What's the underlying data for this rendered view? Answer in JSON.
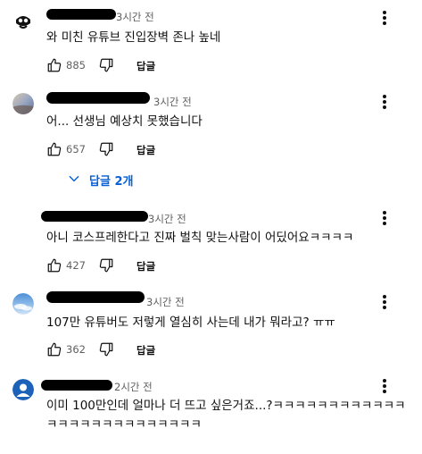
{
  "comments": [
    {
      "author": "",
      "time": "3시간 전",
      "text": "와 미친 유튜브 진입장벽 존나 높네",
      "likes": "885",
      "reply_label": "답글"
    },
    {
      "author": "",
      "time": "3시간 전",
      "text": "어... 선생님 예상치 못했습니다",
      "likes": "657",
      "reply_label": "답글",
      "replies_toggle": "답글 2개"
    },
    {
      "author": "",
      "time": "3시간 전",
      "text": "아니 코스프레한다고 진짜 벌칙 맞는사람이 어딨어요ㅋㅋㅋㅋ",
      "likes": "427",
      "reply_label": "답글"
    },
    {
      "author": "",
      "time": "3시간 전",
      "text": "107만 유튜버도 저렇게 열심히 사는데 내가 뭐라고? ㅠㅠ",
      "likes": "362",
      "reply_label": "답글"
    },
    {
      "author": "",
      "time": "2시간 전",
      "text_line1": "이미 100만인데 얼마나 더 뜨고 싶은거죠...?ㅋㅋㅋㅋㅋㅋㅋㅋㅋㅋㅋㅋ",
      "text_line2": "ㅋㅋㅋㅋㅋㅋㅋㅋㅋㅋㅋㅋㅋㅋ"
    }
  ]
}
